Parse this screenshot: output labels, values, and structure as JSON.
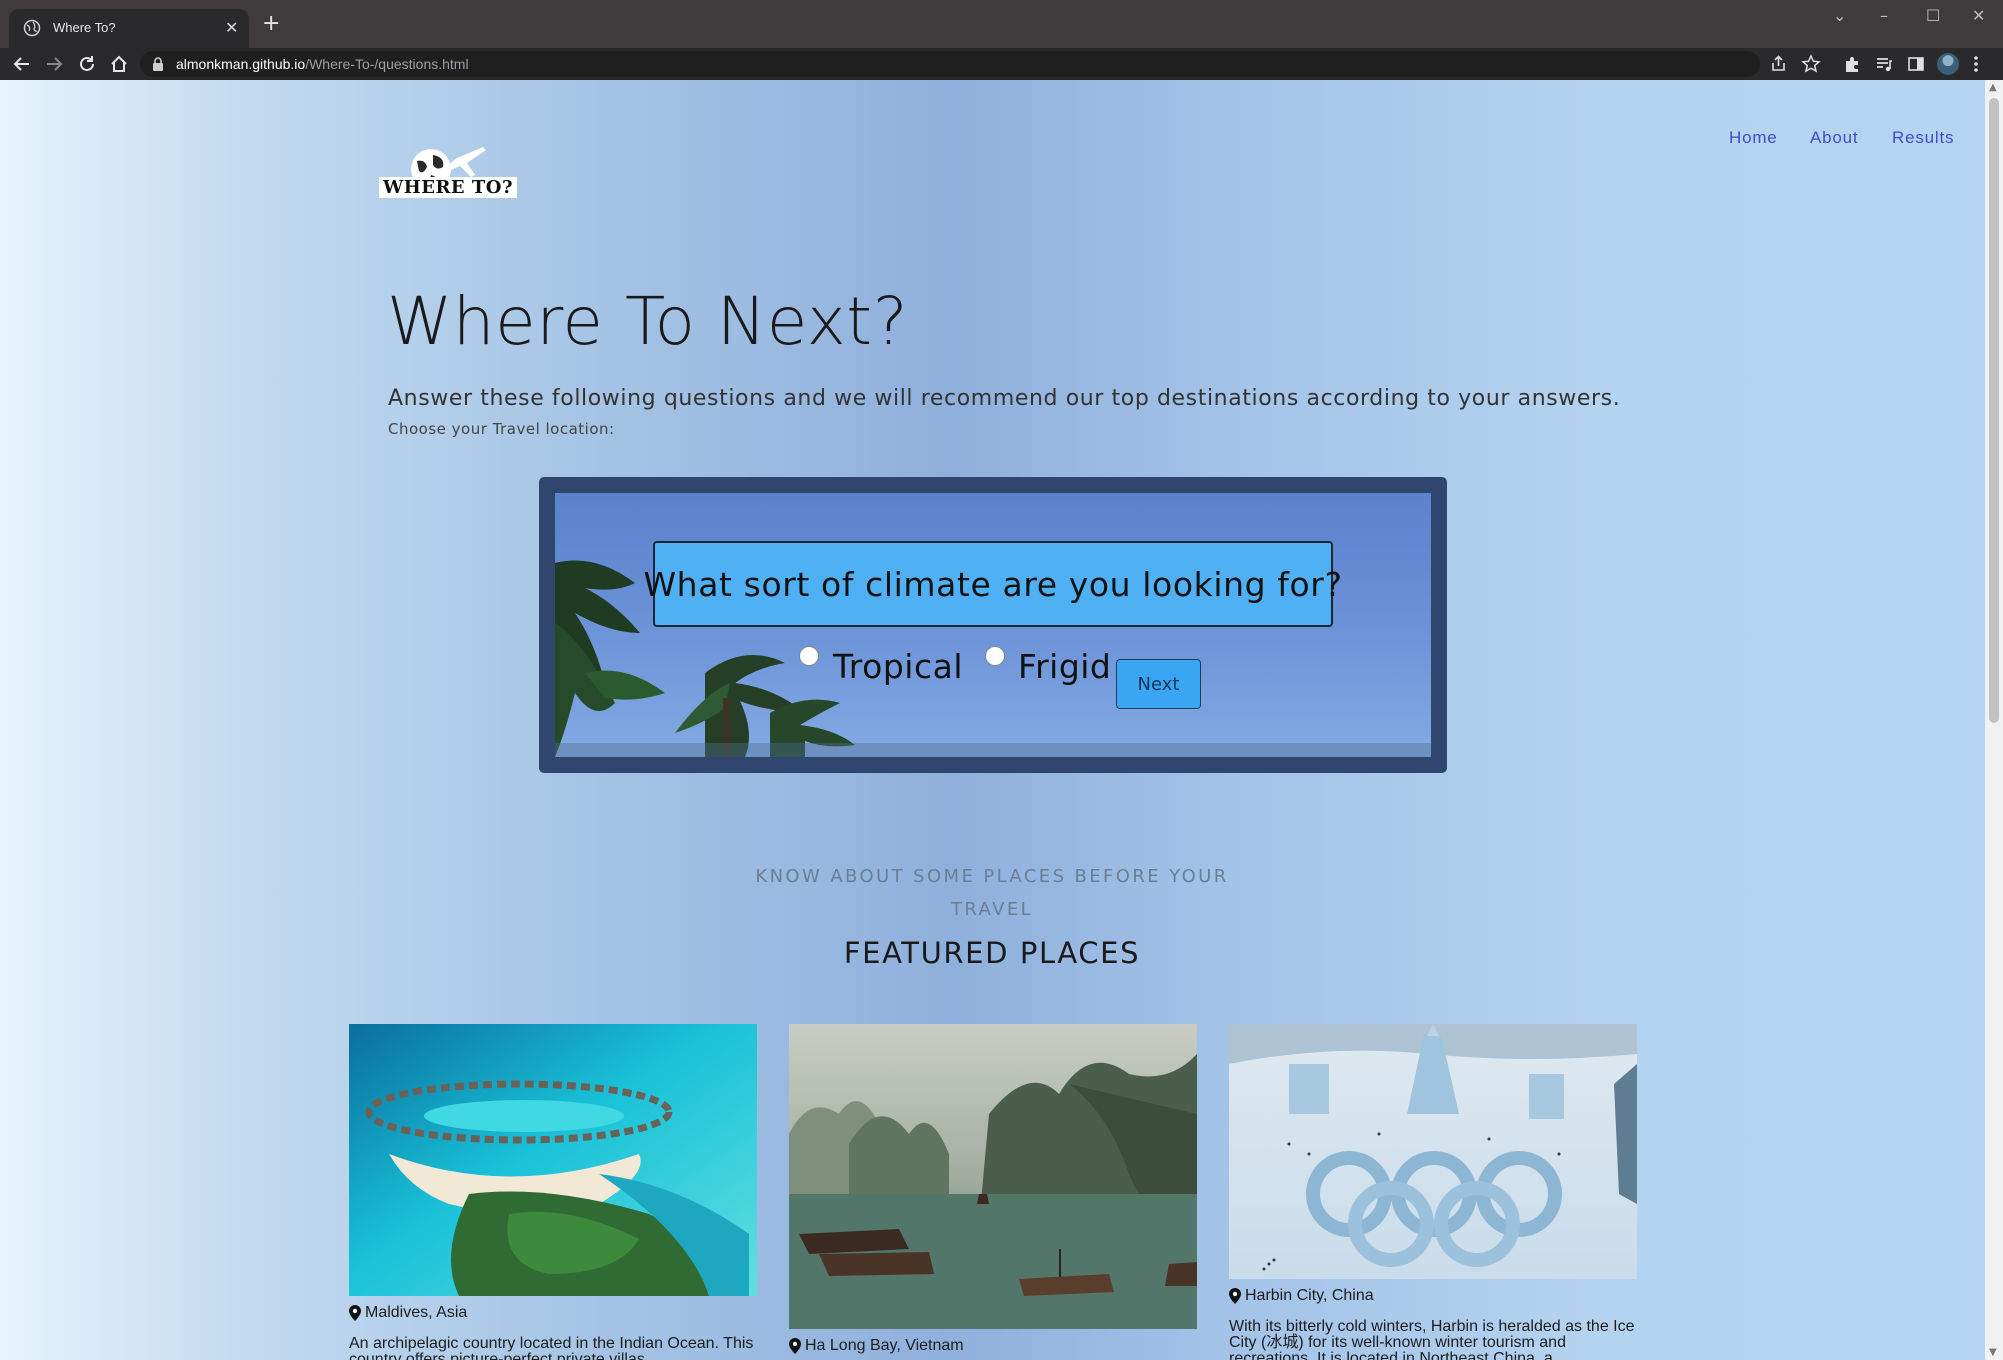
{
  "browser": {
    "tab_title": "Where To?",
    "url_host": "almonkman.github.io",
    "url_path": "/Where-To-/questions.html"
  },
  "site": {
    "logo_text": "WHERE TO?",
    "nav": [
      {
        "label": "Home"
      },
      {
        "label": "About"
      },
      {
        "label": "Results"
      }
    ]
  },
  "hero": {
    "title": "Where To Next?",
    "lead": "Answer these following questions and we will recommend our top destinations according to your answers.",
    "prompt": "Choose your Travel location:"
  },
  "question": {
    "text": "What sort of climate are you looking for?",
    "options": [
      {
        "label": "Tropical",
        "selected": false
      },
      {
        "label": "Frigid",
        "selected": false
      }
    ],
    "next_label": "Next"
  },
  "featured": {
    "kicker": "KNOW ABOUT SOME PLACES BEFORE YOUR TRAVEL",
    "heading": "FEATURED PLACES",
    "places": [
      {
        "location": "Maldives, Asia",
        "description": "An archipelagic country located in the Indian Ocean. This country offers picture-perfect private villas"
      },
      {
        "location": "Ha Long Bay, Vietnam",
        "description": ""
      },
      {
        "location": "Harbin City, China",
        "description": "With its bitterly cold winters, Harbin is heralded as the Ice City (冰城) for its well-known winter tourism and recreations. It is located in Northeast China, a"
      }
    ]
  },
  "colors": {
    "nav_link": "#3d4fc9",
    "question_box": "#4fb1f3",
    "next_button": "#3aa5f2",
    "card_frame": "#30466e"
  }
}
